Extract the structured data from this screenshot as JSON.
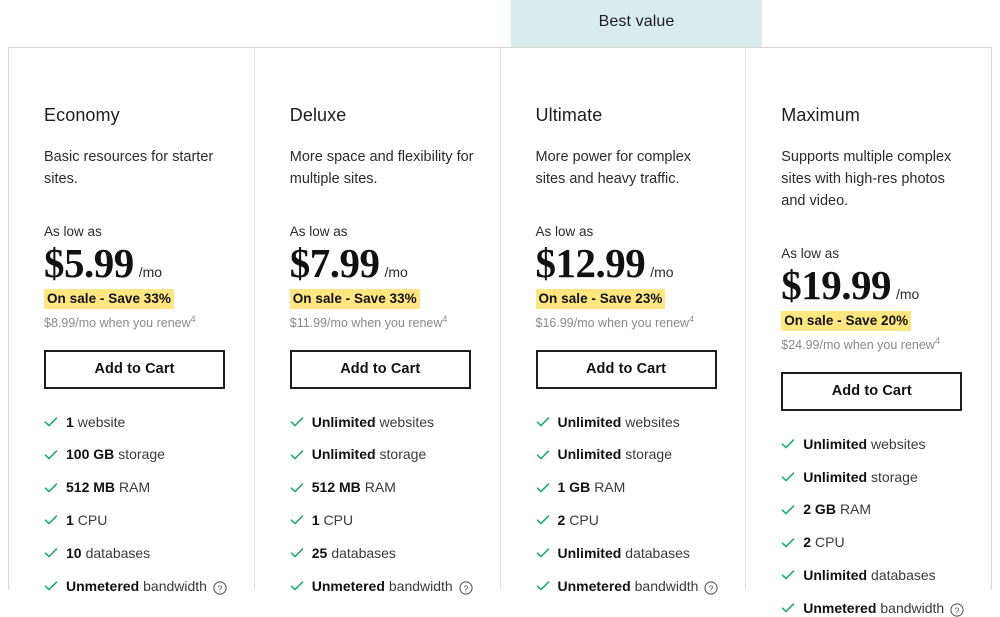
{
  "banner": {
    "label": "Best value",
    "background_color": "#d8ecec",
    "applies_to_plan": "Ultimate"
  },
  "theme": {
    "check_color": "#1fa97f",
    "sale_highlight_color": "#ffe680",
    "border_color": "#d6d6d6",
    "text_color": "#111111"
  },
  "common": {
    "as_low_as_label": "As low as",
    "price_period": "/mo",
    "add_to_cart_label": "Add to Cart",
    "help_icon": "question-circle-icon",
    "check_icon": "check-icon"
  },
  "plans": [
    {
      "name": "Economy",
      "description": "Basic resources for starter sites.",
      "as_low_as_label": "As low as",
      "price": "$5.99",
      "price_period": "/mo",
      "sale_badge": "On sale - Save 33%",
      "renew_note": "$8.99/mo when you renew",
      "renew_footnote": "4",
      "cta_label": "Add to Cart",
      "best_value": false,
      "features": [
        {
          "value": "1",
          "label": "website",
          "has_help": false
        },
        {
          "value": "100 GB",
          "label": "storage",
          "has_help": false
        },
        {
          "value": "512 MB",
          "label": "RAM",
          "has_help": false
        },
        {
          "value": "1",
          "label": "CPU",
          "has_help": false
        },
        {
          "value": "10",
          "label": "databases",
          "has_help": false
        },
        {
          "value": "Unmetered",
          "label": "bandwidth",
          "has_help": true
        }
      ]
    },
    {
      "name": "Deluxe",
      "description": "More space and flexibility for multiple sites.",
      "as_low_as_label": "As low as",
      "price": "$7.99",
      "price_period": "/mo",
      "sale_badge": "On sale - Save 33%",
      "renew_note": "$11.99/mo when you renew",
      "renew_footnote": "4",
      "cta_label": "Add to Cart",
      "best_value": false,
      "features": [
        {
          "value": "Unlimited",
          "label": "websites",
          "has_help": false
        },
        {
          "value": "Unlimited",
          "label": "storage",
          "has_help": false
        },
        {
          "value": "512 MB",
          "label": "RAM",
          "has_help": false
        },
        {
          "value": "1",
          "label": "CPU",
          "has_help": false
        },
        {
          "value": "25",
          "label": "databases",
          "has_help": false
        },
        {
          "value": "Unmetered",
          "label": "bandwidth",
          "has_help": true
        }
      ]
    },
    {
      "name": "Ultimate",
      "description": "More power for complex sites and heavy traffic.",
      "as_low_as_label": "As low as",
      "price": "$12.99",
      "price_period": "/mo",
      "sale_badge": "On sale - Save 23%",
      "renew_note": "$16.99/mo when you renew",
      "renew_footnote": "4",
      "cta_label": "Add to Cart",
      "best_value": true,
      "features": [
        {
          "value": "Unlimited",
          "label": "websites",
          "has_help": false
        },
        {
          "value": "Unlimited",
          "label": "storage",
          "has_help": false
        },
        {
          "value": "1 GB",
          "label": "RAM",
          "has_help": false
        },
        {
          "value": "2",
          "label": "CPU",
          "has_help": false
        },
        {
          "value": "Unlimited",
          "label": "databases",
          "has_help": false
        },
        {
          "value": "Unmetered",
          "label": "bandwidth",
          "has_help": true
        }
      ]
    },
    {
      "name": "Maximum",
      "description": "Supports multiple complex sites with high-res photos and video.",
      "as_low_as_label": "As low as",
      "price": "$19.99",
      "price_period": "/mo",
      "sale_badge": "On sale - Save 20%",
      "renew_note": "$24.99/mo when you renew",
      "renew_footnote": "4",
      "cta_label": "Add to Cart",
      "best_value": false,
      "features": [
        {
          "value": "Unlimited",
          "label": "websites",
          "has_help": false
        },
        {
          "value": "Unlimited",
          "label": "storage",
          "has_help": false
        },
        {
          "value": "2 GB",
          "label": "RAM",
          "has_help": false
        },
        {
          "value": "2",
          "label": "CPU",
          "has_help": false
        },
        {
          "value": "Unlimited",
          "label": "databases",
          "has_help": false
        },
        {
          "value": "Unmetered",
          "label": "bandwidth",
          "has_help": true
        }
      ]
    }
  ]
}
